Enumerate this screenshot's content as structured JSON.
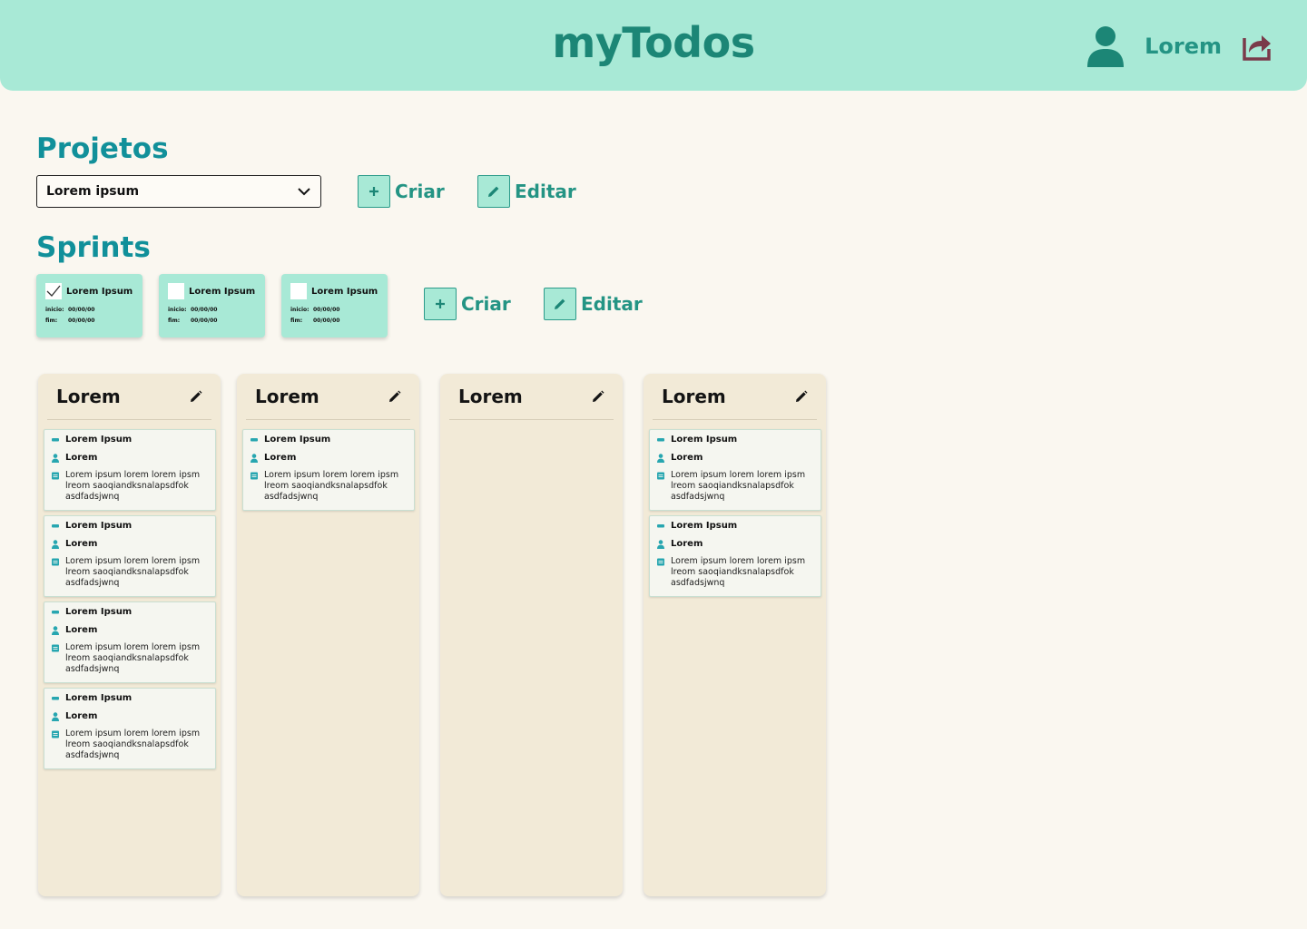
{
  "header": {
    "app_title": "myTodos",
    "user_name": "Lorem",
    "brand_color": "#a8e9d6",
    "accent_color": "#1c8676",
    "logout_color": "#7a3a4a"
  },
  "projects": {
    "title": "Projetos",
    "selected": "Lorem ipsum",
    "create_label": "Criar",
    "edit_label": "Editar"
  },
  "sprints": {
    "title": "Sprints",
    "create_label": "Criar",
    "edit_label": "Editar",
    "start_label": "inicio:",
    "end_label": "fim:",
    "items": [
      {
        "name": "Lorem Ipsum",
        "checked": true,
        "start": "00/00/00",
        "end": "00/00/00"
      },
      {
        "name": "Lorem Ipsum",
        "checked": false,
        "start": "00/00/00",
        "end": "00/00/00"
      },
      {
        "name": "Lorem Ipsum",
        "checked": false,
        "start": "00/00/00",
        "end": "00/00/00"
      }
    ]
  },
  "board": {
    "columns": [
      {
        "title": "Lorem",
        "cards": [
          {
            "title": "Lorem Ipsum",
            "assignee": "Lorem",
            "description": "Lorem ipsum lorem lorem ipsm lreom saoqiandksnalapsdfok asdfadsjwnq"
          },
          {
            "title": "Lorem Ipsum",
            "assignee": "Lorem",
            "description": "Lorem ipsum lorem lorem ipsm lreom saoqiandksnalapsdfok asdfadsjwnq"
          },
          {
            "title": "Lorem Ipsum",
            "assignee": "Lorem",
            "description": "Lorem ipsum lorem lorem ipsm lreom saoqiandksnalapsdfok asdfadsjwnq"
          },
          {
            "title": "Lorem Ipsum",
            "assignee": "Lorem",
            "description": "Lorem ipsum lorem lorem ipsm lreom saoqiandksnalapsdfok asdfadsjwnq"
          }
        ]
      },
      {
        "title": "Lorem",
        "cards": [
          {
            "title": "Lorem Ipsum",
            "assignee": "Lorem",
            "description": "Lorem ipsum lorem lorem ipsm lreom saoqiandksnalapsdfok asdfadsjwnq"
          }
        ]
      },
      {
        "title": "Lorem",
        "cards": []
      },
      {
        "title": "Lorem",
        "cards": [
          {
            "title": "Lorem Ipsum",
            "assignee": "Lorem",
            "description": "Lorem ipsum lorem lorem ipsm lreom saoqiandksnalapsdfok asdfadsjwnq"
          },
          {
            "title": "Lorem Ipsum",
            "assignee": "Lorem",
            "description": "Lorem ipsum lorem lorem ipsm lreom saoqiandksnalapsdfok asdfadsjwnq"
          }
        ]
      }
    ]
  }
}
